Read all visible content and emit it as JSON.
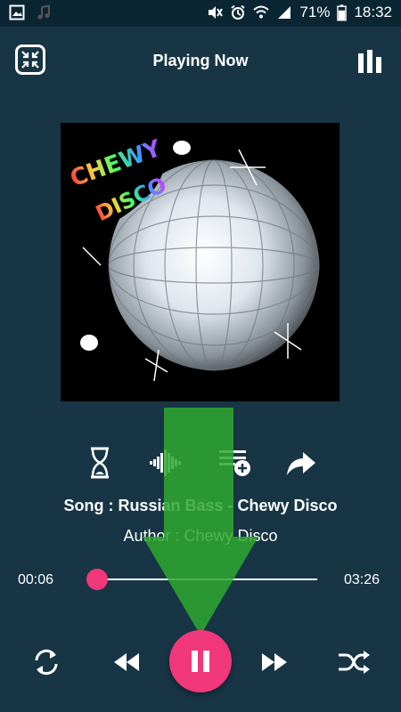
{
  "status_bar": {
    "battery": "71%",
    "time": "18:32",
    "icons": [
      "gallery-icon",
      "music-note-icon",
      "mute-icon",
      "alarm-icon",
      "wifi-icon",
      "signal-icon",
      "battery-icon"
    ]
  },
  "header": {
    "title": "Playing Now",
    "left_icon": "collapse-icon",
    "right_icon": "equalizer-icon"
  },
  "album_art": {
    "text_line1": "CHEWY",
    "text_line2": "DISCO"
  },
  "actions": {
    "icons": [
      "timer-icon",
      "visualizer-icon",
      "add-to-playlist-icon",
      "share-icon"
    ]
  },
  "track": {
    "song": "Song : Russian Bass - Chewy Disco",
    "author": "Author : Chewy Disco",
    "elapsed": "00:06",
    "duration": "03:26",
    "progress": 0.03
  },
  "controls": {
    "icons": [
      "repeat-icon",
      "previous-icon",
      "pause-icon",
      "next-icon",
      "shuffle-icon"
    ]
  },
  "colors": {
    "background": "#173545",
    "accent": "#f1387a",
    "overlay_arrow": "#2fa82f"
  }
}
